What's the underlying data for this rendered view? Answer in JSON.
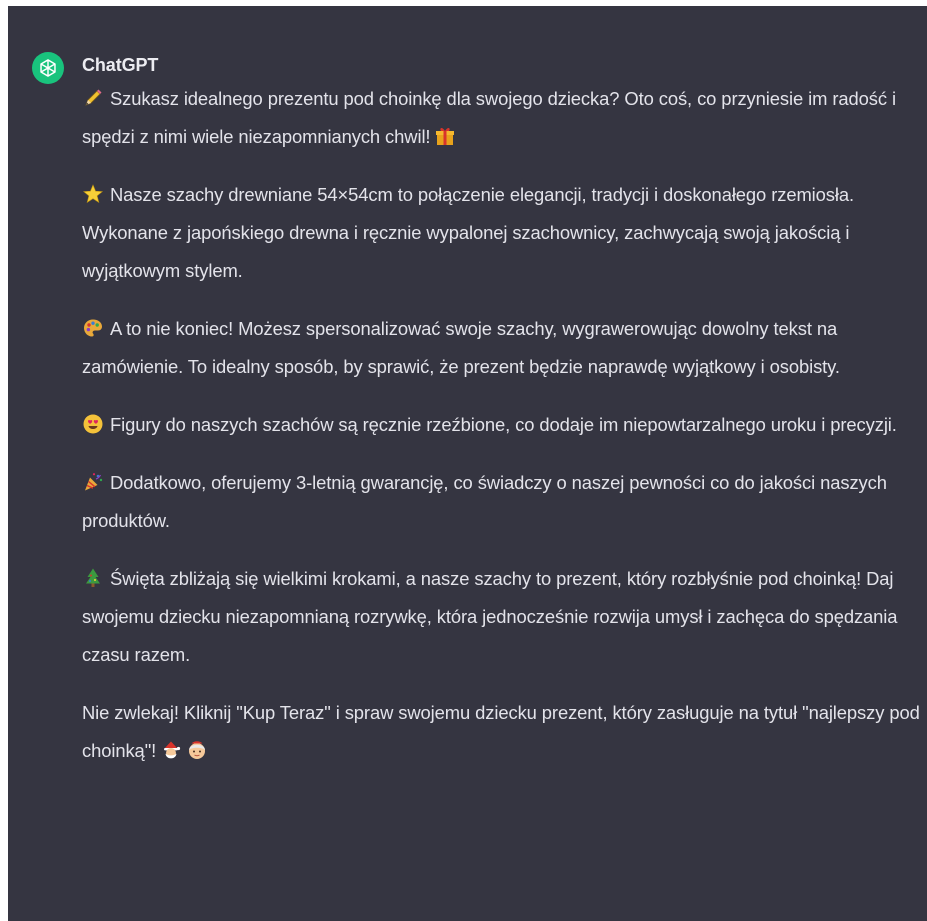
{
  "message": {
    "author": "ChatGPT",
    "avatar_icon": "openai-logo-icon",
    "avatar_color": "#19c37d",
    "background_color": "#353541",
    "paragraphs": [
      {
        "emoji": "pencil-icon",
        "text": "Szukasz idealnego prezentu pod choinkę dla swojego dziecka? Oto coś, co przyniesie im radość i spędzi z nimi wiele niezapomnianych chwil!",
        "trailing_emoji": "gift-icon"
      },
      {
        "emoji": "star-icon",
        "text": "Nasze szachy drewniane 54×54cm to połączenie elegancji, tradycji i doskonałego rzemiosła. Wykonane z japońskiego drewna i ręcznie wypalonej szachownicy, zachwycają swoją jakością i wyjątkowym stylem."
      },
      {
        "emoji": "painter-palette-icon",
        "text": "A to nie koniec! Możesz spersonalizować swoje szachy, wygrawerowując dowolny tekst na zamówienie. To idealny sposób, by sprawić, że prezent będzie naprawdę wyjątkowy i osobisty."
      },
      {
        "emoji": "heart-eyes-face-icon",
        "text": "Figury do naszych szachów są ręcznie rzeźbione, co dodaje im niepowtarzalnego uroku i precyzji."
      },
      {
        "emoji": "party-popper-icon",
        "text": "Dodatkowo, oferujemy 3-letnią gwarancję, co świadczy o naszej pewności co do jakości naszych produktów."
      },
      {
        "emoji": "christmas-tree-icon",
        "text": "Święta zbliżają się wielkimi krokami, a nasze szachy to prezent, który rozbłyśnie pod choinką! Daj swojemu dziecku niezapomnianą rozrywkę, która jednocześnie rozwija umysł i zachęca do spędzania czasu razem."
      },
      {
        "text": "Nie zwlekaj! Kliknij \"Kup Teraz\" i spraw swojemu dziecku prezent, który zasługuje na tytuł \"najlepszy pod choinką\"!",
        "trailing_emojis": [
          "santa-claus-icon",
          "mrs-claus-icon"
        ]
      }
    ]
  }
}
